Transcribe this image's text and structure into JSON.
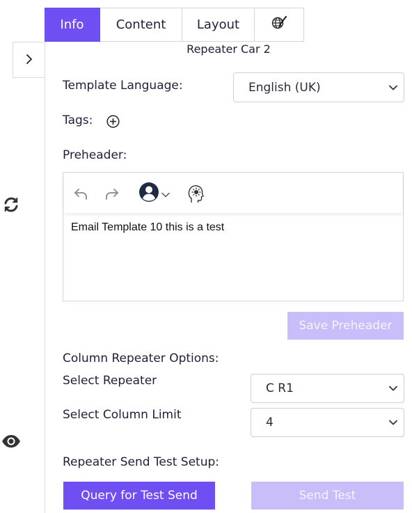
{
  "tabs": [
    {
      "label": "Info",
      "active": true
    },
    {
      "label": "Content",
      "active": false
    },
    {
      "label": "Layout",
      "active": false
    },
    {
      "label": "",
      "icon": "globe-brush-icon",
      "active": false
    }
  ],
  "rail": {
    "collapse_icon": "chevron-right-icon",
    "refresh_icon": "refresh-icon",
    "preview_icon": "eye-icon"
  },
  "panel": {
    "template_name": "Repeater Car 2",
    "template_language_label": "Template Language:",
    "template_language_value": "English (UK)",
    "tags_label": "Tags:",
    "add_tag_icon": "plus-circle-icon",
    "preheader_label": "Preheader:",
    "preheader_toolbar": {
      "undo_icon": "undo-icon",
      "redo_icon": "redo-icon",
      "personalize_icon": "user-circle-icon",
      "ai_icon": "ai-head-icon"
    },
    "preheader_text": "Email Template 10 this is a test",
    "save_preheader_label": "Save Preheader",
    "column_repeater_label": "Column Repeater Options:",
    "select_repeater_label": "Select Repeater",
    "select_repeater_value": "C R1",
    "select_column_limit_label": "Select Column Limit",
    "select_column_limit_value": "4",
    "repeater_send_test_label": "Repeater Send Test Setup:",
    "query_button_label": "Query for Test Send",
    "send_test_label": "Send Test"
  },
  "colors": {
    "accent": "#6f4ef2",
    "accent_disabled": "#c9befa",
    "text": "#1f1f3a",
    "border": "#d4d4dc"
  }
}
